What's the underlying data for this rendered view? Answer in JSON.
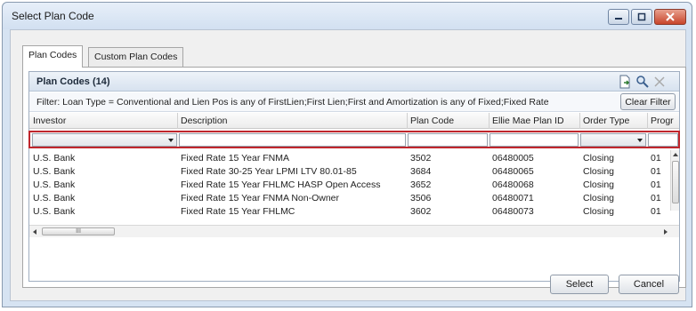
{
  "window": {
    "title": "Select Plan Code"
  },
  "tabs": [
    {
      "label": "Plan Codes",
      "active": true
    },
    {
      "label": "Custom Plan Codes",
      "active": false
    }
  ],
  "group": {
    "title": "Plan Codes (14)",
    "icons": [
      "export-icon",
      "search-icon",
      "clear-icon"
    ]
  },
  "filter": {
    "text": "Filter: Loan Type = Conventional  and  Lien Pos is any of FirstLien;First Lien;First  and  Amortization is any of Fixed;Fixed Rate",
    "clear_label": "Clear Filter"
  },
  "table": {
    "columns": [
      "Investor",
      "Description",
      "Plan Code",
      "Ellie Mae Plan ID",
      "Order Type",
      "Progr"
    ],
    "rows": [
      [
        "U.S. Bank",
        "Fixed Rate 15 Year  FNMA",
        "3502",
        "06480005",
        "Closing",
        "01"
      ],
      [
        "U.S. Bank",
        "Fixed Rate 30-25 Year LPMI LTV 80.01-85",
        "3684",
        "06480065",
        "Closing",
        "01"
      ],
      [
        "U.S. Bank",
        "Fixed Rate 15 Year FHLMC HASP Open Access",
        "3652",
        "06480068",
        "Closing",
        "01"
      ],
      [
        "U.S. Bank",
        "Fixed Rate 15 Year  FNMA Non-Owner",
        "3506",
        "06480071",
        "Closing",
        "01"
      ],
      [
        "U.S. Bank",
        "Fixed Rate 15 Year FHLMC",
        "3602",
        "06480073",
        "Closing",
        "01"
      ]
    ]
  },
  "scroll": {
    "hscroll_grip": "III"
  },
  "buttons": {
    "select": "Select",
    "cancel": "Cancel"
  }
}
